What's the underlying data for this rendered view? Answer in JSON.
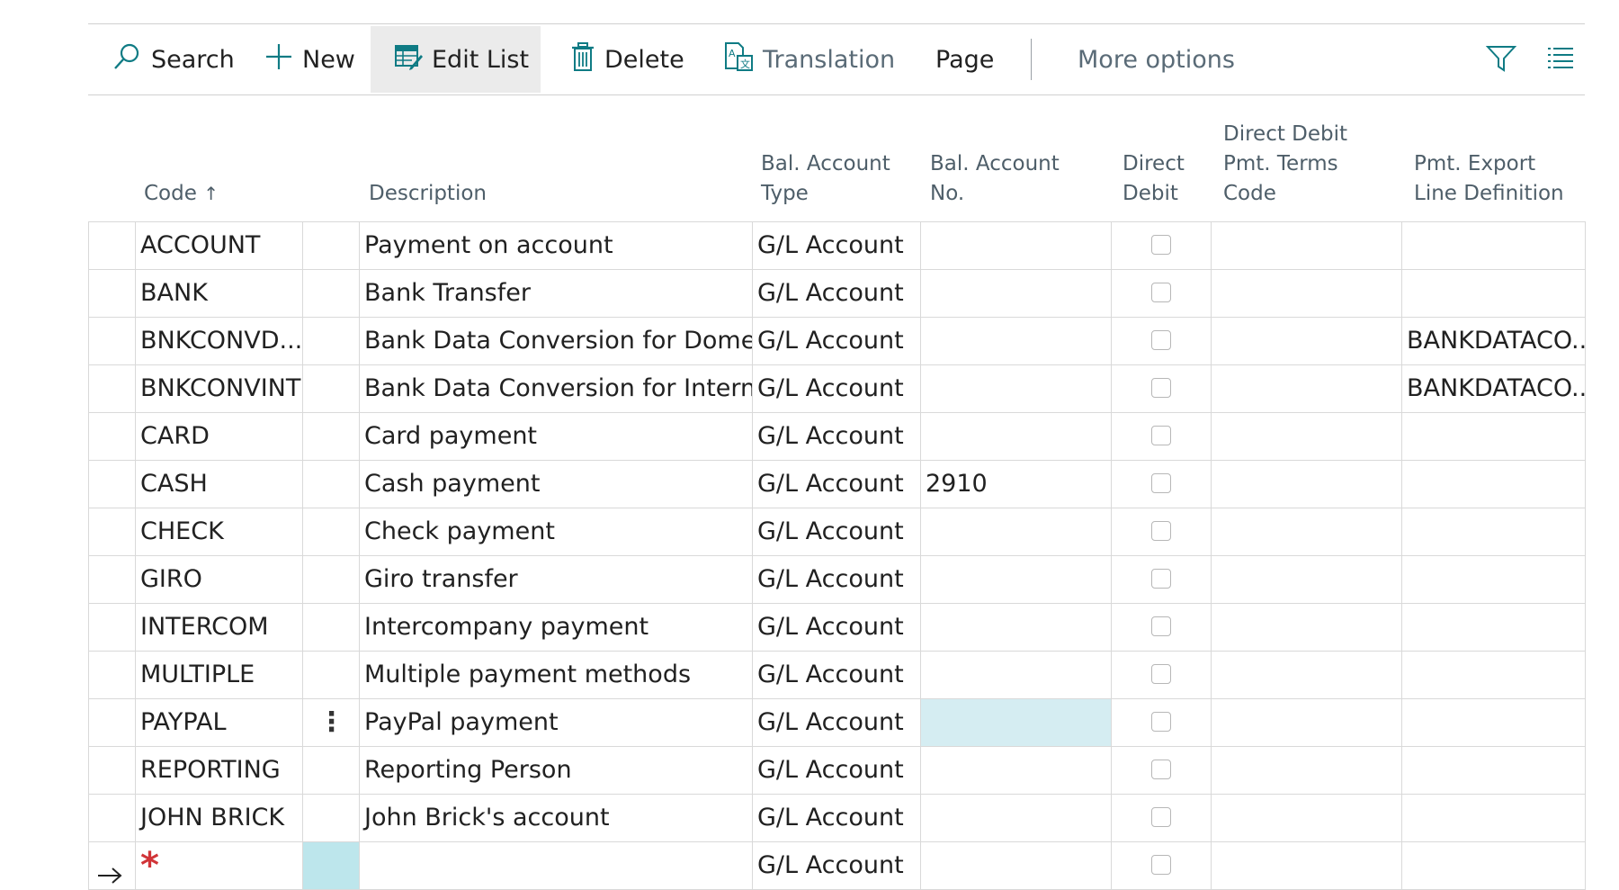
{
  "toolbar": {
    "search": "Search",
    "new": "New",
    "edit_list": "Edit List",
    "delete": "Delete",
    "translation": "Translation",
    "page": "Page",
    "more_options": "More options"
  },
  "columns": {
    "code": "Code",
    "description": "Description",
    "bal_account_type": [
      "Bal. Account",
      "Type"
    ],
    "bal_account_no": [
      "Bal. Account",
      "No."
    ],
    "direct_debit": [
      "Direct",
      "Debit"
    ],
    "direct_debit_terms": [
      "Direct Debit",
      "Pmt. Terms",
      "Code"
    ],
    "pmt_export": [
      "Pmt. Export",
      "Line Definition"
    ]
  },
  "rows": [
    {
      "code": "ACCOUNT",
      "description": "Payment on account",
      "bal_type": "G/L Account",
      "bal_no": "",
      "pmt_export": ""
    },
    {
      "code": "BANK",
      "description": "Bank Transfer",
      "bal_type": "G/L Account",
      "bal_no": "",
      "pmt_export": ""
    },
    {
      "code": "BNKCONVD...",
      "description": "Bank Data Conversion for Dome...",
      "bal_type": "G/L Account",
      "bal_no": "",
      "pmt_export": "BANKDATACO..."
    },
    {
      "code": "BNKCONVINT",
      "description": "Bank Data Conversion for Intern...",
      "bal_type": "G/L Account",
      "bal_no": "",
      "pmt_export": "BANKDATACO..."
    },
    {
      "code": "CARD",
      "description": "Card payment",
      "bal_type": "G/L Account",
      "bal_no": "",
      "pmt_export": ""
    },
    {
      "code": "CASH",
      "description": "Cash payment",
      "bal_type": "G/L Account",
      "bal_no": "2910",
      "pmt_export": ""
    },
    {
      "code": "CHECK",
      "description": "Check payment",
      "bal_type": "G/L Account",
      "bal_no": "",
      "pmt_export": ""
    },
    {
      "code": "GIRO",
      "description": "Giro transfer",
      "bal_type": "G/L Account",
      "bal_no": "",
      "pmt_export": ""
    },
    {
      "code": "INTERCOM",
      "description": "Intercompany payment",
      "bal_type": "G/L Account",
      "bal_no": "",
      "pmt_export": ""
    },
    {
      "code": "MULTIPLE",
      "description": "Multiple payment methods",
      "bal_type": "G/L Account",
      "bal_no": "",
      "pmt_export": ""
    },
    {
      "code": "PAYPAL",
      "description": "PayPal payment",
      "bal_type": "G/L Account",
      "bal_no": "",
      "pmt_export": ""
    },
    {
      "code": "REPORTING",
      "description": "Reporting Person",
      "bal_type": "G/L Account",
      "bal_no": "",
      "pmt_export": ""
    },
    {
      "code": "JOHN BRICK",
      "description": "John Brick's account",
      "bal_type": "G/L Account",
      "bal_no": "",
      "pmt_export": ""
    },
    {
      "code": "",
      "description": "",
      "bal_type": "G/L Account",
      "bal_no": "",
      "pmt_export": ""
    }
  ],
  "colors": {
    "accent": "#0f7b84",
    "active_cell": "#d5edf2",
    "new_row_cell": "#bde6ec",
    "required_marker": "#d13438"
  }
}
